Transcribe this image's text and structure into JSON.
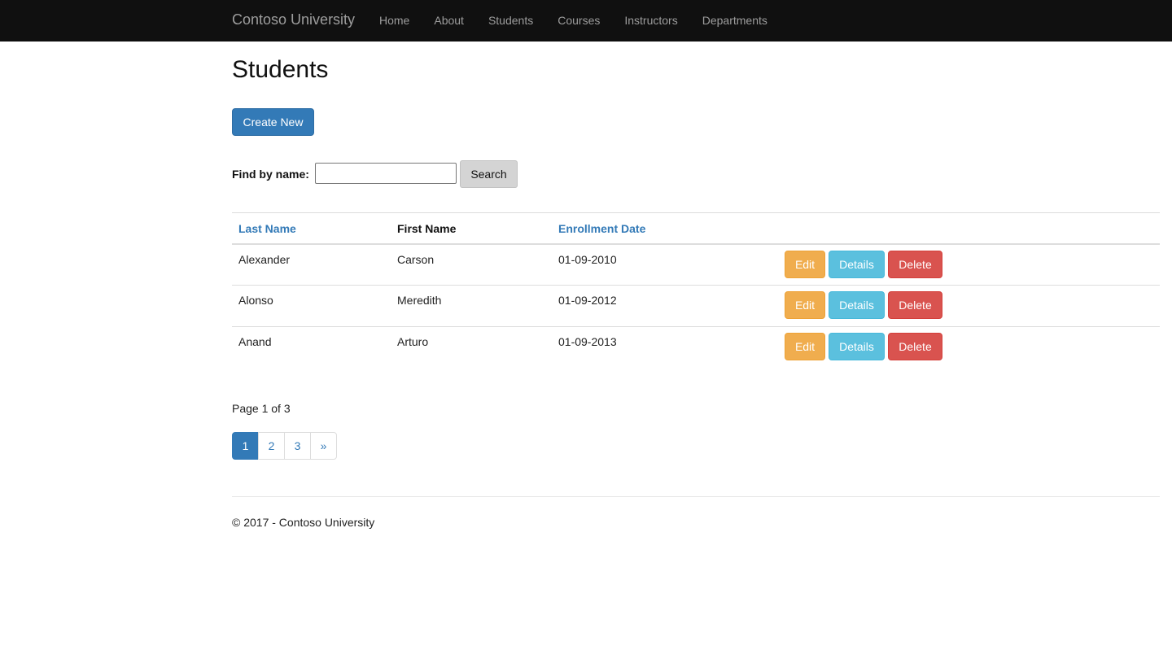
{
  "navbar": {
    "brand": "Contoso University",
    "items": [
      "Home",
      "About",
      "Students",
      "Courses",
      "Instructors",
      "Departments"
    ]
  },
  "page": {
    "title": "Students",
    "create_label": "Create New"
  },
  "search": {
    "label": "Find by name:",
    "value": "",
    "button_label": "Search"
  },
  "table": {
    "headers": {
      "last_name": "Last Name",
      "first_name": "First Name",
      "enrollment_date": "Enrollment Date"
    },
    "rows": [
      {
        "last_name": "Alexander",
        "first_name": "Carson",
        "enrollment_date": "01-09-2010"
      },
      {
        "last_name": "Alonso",
        "first_name": "Meredith",
        "enrollment_date": "01-09-2012"
      },
      {
        "last_name": "Anand",
        "first_name": "Arturo",
        "enrollment_date": "01-09-2013"
      }
    ],
    "actions": {
      "edit": "Edit",
      "details": "Details",
      "delete": "Delete"
    }
  },
  "paging": {
    "info": "Page 1 of 3",
    "pages": [
      "1",
      "2",
      "3"
    ],
    "current": "1",
    "next": "»"
  },
  "footer": {
    "text": "© 2017 - Contoso University"
  },
  "colors": {
    "navbar_bg": "#101010",
    "primary": "#337ab7",
    "warning": "#f0ad4e",
    "info": "#5bc0de",
    "danger": "#d9534f"
  }
}
